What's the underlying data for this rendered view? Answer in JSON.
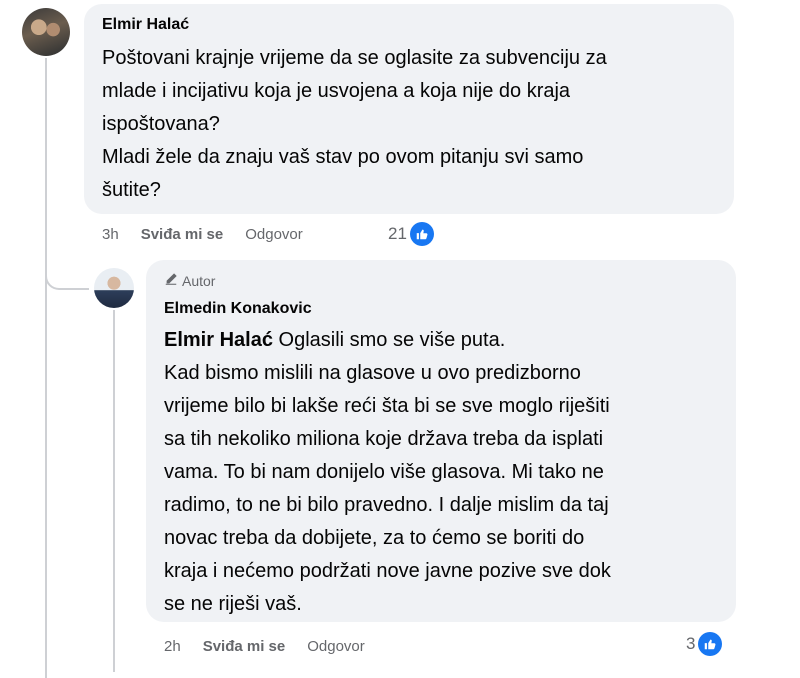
{
  "comments": [
    {
      "author": "Elmir Halać",
      "text": "Poštovani krajnje vrijeme da se oglasite za subvenciju za\nmlade i incijativu koja je usvojena a koja nije do kraja\nispoštovana?\nMladi žele da znaju vaš stav po ovom pitanju svi samo\nšutite?",
      "time": "3h",
      "like_label": "Sviđa mi se",
      "reply_label": "Odgovor",
      "reaction_count": "21",
      "reaction_icon": "like-icon",
      "accent": "#1877f2"
    }
  ],
  "reply": {
    "badge_label": "Autor",
    "badge_icon": "pencil-icon",
    "author": "Elmedin Konakovic",
    "mention": "Elmir Halać",
    "text": " Oglasili smo se više puta.\nKad bismo mislili na glasove u ovo predizborno\nvrijeme bilo bi lakše reći šta bi se sve moglo riješiti\nsa tih nekoliko miliona koje država treba da isplati\nvama. To bi nam donijelo više glasova. Mi tako ne\nradimo, to ne bi bilo pravedno. I dalje mislim da taj\nnovac treba da dobijete, za to ćemo se boriti do\nkraja i nećemo podržati nove javne pozive sve dok\nse ne riješi vaš.",
    "time": "2h",
    "like_label": "Sviđa mi se",
    "reply_label": "Odgovor",
    "reaction_count": "3",
    "reaction_icon": "like-icon"
  }
}
